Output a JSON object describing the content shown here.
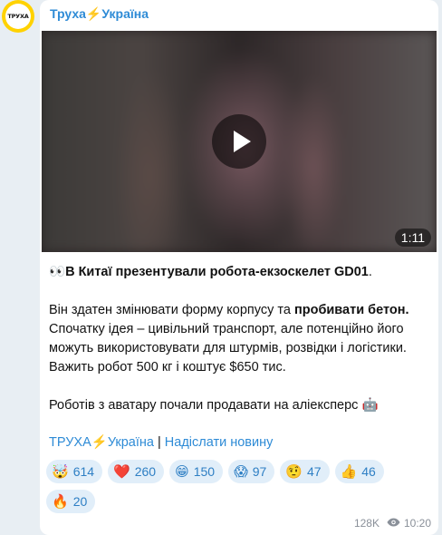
{
  "channel": {
    "avatar_text": "ТРУХА",
    "name": "Труха⚡Україна"
  },
  "video": {
    "duration": "1:11"
  },
  "message": {
    "line1_prefix": "👀",
    "line1_bold": "В Китаї презентували робота-екзоскелет GD01",
    "line1_suffix": ".",
    "para2_text": "Він здатен змінювати форму корпусу та ",
    "para2_bold": "пробивати бетон.",
    "para2_rest": " Спочатку ідея – цивільний транспорт, але потенційно його можуть використовувати для штурмів, розвідки і логістики. Важить робот 500 кг і коштує $650 тис.",
    "para3": "Роботів з аватару почали продавати на аліексперс 🤖"
  },
  "links": {
    "channel_link": "ТРУХА⚡Україна",
    "separator": " | ",
    "submit_link": "Надіслати новину"
  },
  "reactions": [
    {
      "emoji": "🤯",
      "count": "614"
    },
    {
      "emoji": "❤️",
      "count": "260"
    },
    {
      "emoji": "😁",
      "count": "150"
    },
    {
      "emoji": "😱",
      "count": "97"
    },
    {
      "emoji": "🤨",
      "count": "47"
    },
    {
      "emoji": "👍",
      "count": "46"
    },
    {
      "emoji": "🔥",
      "count": "20"
    }
  ],
  "footer": {
    "views": "128K",
    "time": "10:20"
  }
}
